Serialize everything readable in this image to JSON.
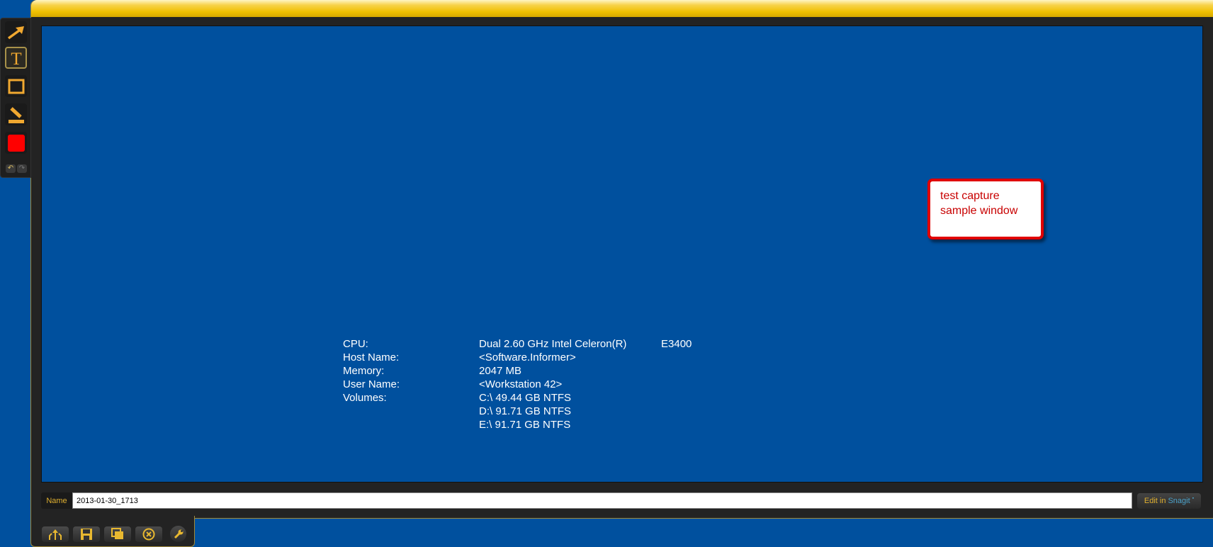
{
  "toolbar": {
    "tools": [
      {
        "icon": "arrow-icon"
      },
      {
        "icon": "text-icon",
        "selected": true
      },
      {
        "icon": "rectangle-icon"
      },
      {
        "icon": "highlighter-icon"
      },
      {
        "icon": "color-swatch",
        "color": "#ff0000"
      }
    ],
    "undo_icon": "undo-icon",
    "redo_icon": "redo-icon"
  },
  "capture": {
    "info": [
      {
        "label": "CPU:",
        "value": "Dual 2.60 GHz Intel Celeron(R)",
        "extra": "E3400"
      },
      {
        "label": "Host Name:",
        "value": "<Software.Informer>"
      },
      {
        "label": "Memory:",
        "value": "2047 MB"
      },
      {
        "label": "User Name:",
        "value": "<Workstation 42>"
      },
      {
        "label": "Volumes:",
        "value": "C:\\ 49.44 GB NTFS"
      },
      {
        "label": "",
        "value": "D:\\ 91.71 GB NTFS"
      },
      {
        "label": "",
        "value": "E:\\ 91.71 GB NTFS"
      }
    ],
    "callout": {
      "line1": "test capture",
      "line2": "sample window",
      "color": "#e00000"
    }
  },
  "namebar": {
    "label": "Name",
    "value": "2013-01-30_1713"
  },
  "edit_button": {
    "prefix": "Edit in",
    "brand": "Snagit"
  },
  "bottom_buttons": [
    "share-icon",
    "save-icon",
    "copy-icon",
    "close-circle-icon",
    "wrench-icon"
  ],
  "colors": {
    "accent": "#f0c000",
    "background": "#00509e"
  }
}
